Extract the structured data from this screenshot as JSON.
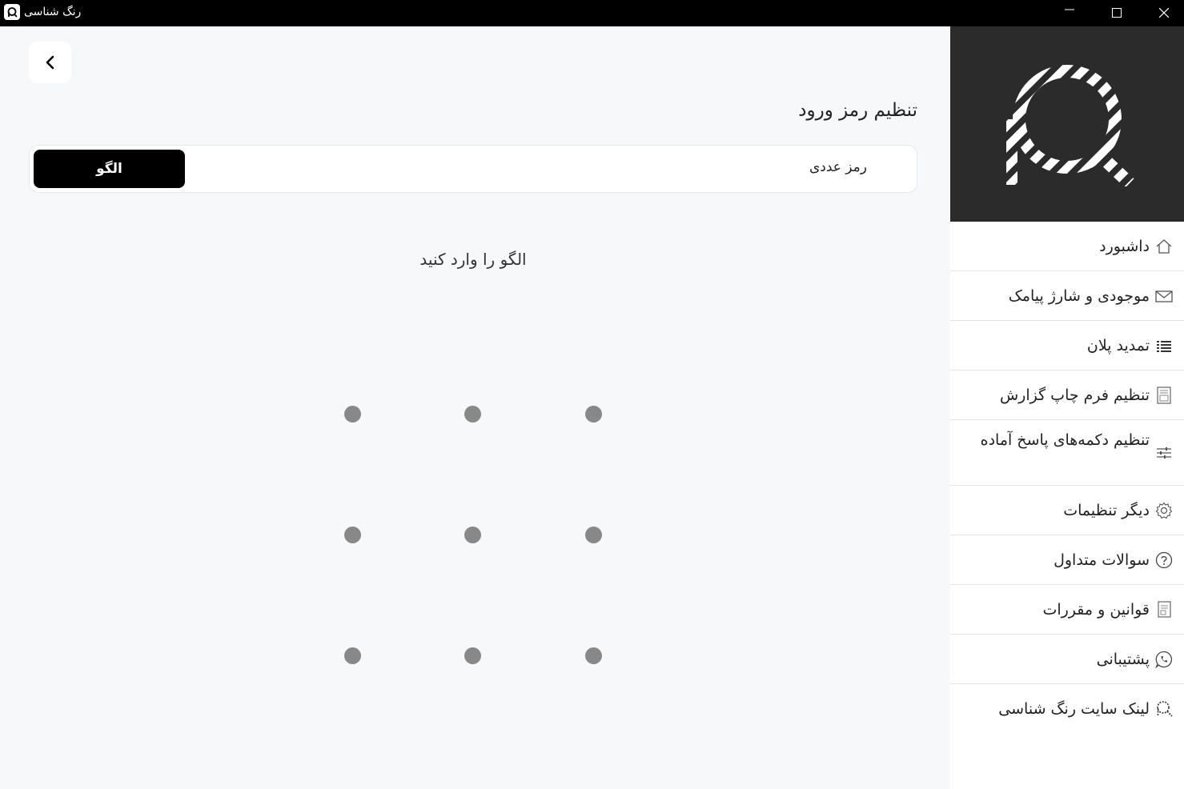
{
  "window": {
    "title": "رنگ شناسی"
  },
  "main": {
    "page_title": "تنظیم رمز ورود",
    "tabs": {
      "numeric": "رمز عددی",
      "pattern": "الگو"
    },
    "prompt": "الگو را وارد کنید"
  },
  "sidebar": {
    "items": [
      {
        "label": "داشبورد",
        "icon": "home-icon"
      },
      {
        "label": "موجودی و شارژ پیامک",
        "icon": "mail-icon"
      },
      {
        "label": "تمدید پلان",
        "icon": "list-icon"
      },
      {
        "label": "تنظیم فرم چاپ گزارش",
        "icon": "document-icon"
      },
      {
        "label": "تنظیم دکمه‌های پاسخ آماده",
        "icon": "sliders-icon"
      },
      {
        "label": "دیگر تنظیمات",
        "icon": "gear-icon"
      },
      {
        "label": "سوالات متداول",
        "icon": "question-icon"
      },
      {
        "label": "قوانین و مقررات",
        "icon": "rules-icon"
      },
      {
        "label": "پشتیبانی",
        "icon": "whatsapp-icon"
      },
      {
        "label": "لینک سایت رنگ شناسی",
        "icon": "link-logo-icon"
      }
    ]
  },
  "colors": {
    "titlebar": "#000000",
    "sidebar_header": "#2b2b2b",
    "active_tab": "#000000",
    "dot": "#888888",
    "background": "#f7f8fa"
  }
}
